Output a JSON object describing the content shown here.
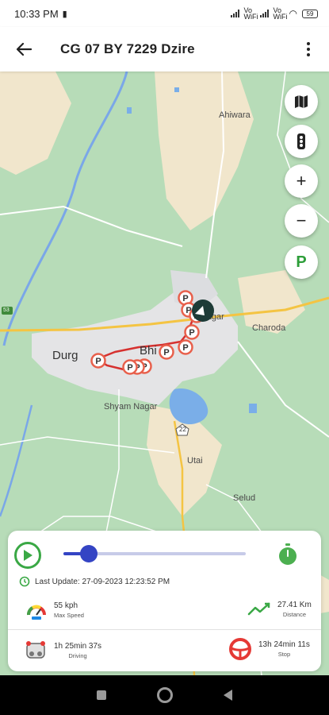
{
  "status": {
    "time": "10:33 PM",
    "net1": "Vo WiFi",
    "net2": "Vo WiFi",
    "battery": "59"
  },
  "appbar": {
    "title": "CG 07 BY 7229 Dzire"
  },
  "map": {
    "labels": {
      "ahiwara": "Ahiwara",
      "durg": "Durg",
      "bhilai": "Bhi",
      "nagar": "Ga   agar",
      "charoda": "Charoda",
      "shyam_nagar": "Shyam Nagar",
      "utai": "Utai",
      "selud": "Selud",
      "route53": "53",
      "route22": "22"
    },
    "fab_parking": "P",
    "pin_letter": "P"
  },
  "card": {
    "playback_progress": 0.14,
    "last_update": "Last Update: 27-09-2023 12:23:52 PM",
    "max_speed": {
      "value": "55 kph",
      "label": "Max Speed"
    },
    "distance": {
      "value": "27.41 Km",
      "label": "Distance"
    },
    "driving": {
      "value": "1h 25min 37s",
      "label": "Driving"
    },
    "stop": {
      "value": "13h 24min 11s",
      "label": "Stop"
    }
  },
  "colors": {
    "accent_green": "#3aa845",
    "slider_blue": "#3444c4",
    "route_red": "#d6312f",
    "pin_red": "#e8604c"
  }
}
